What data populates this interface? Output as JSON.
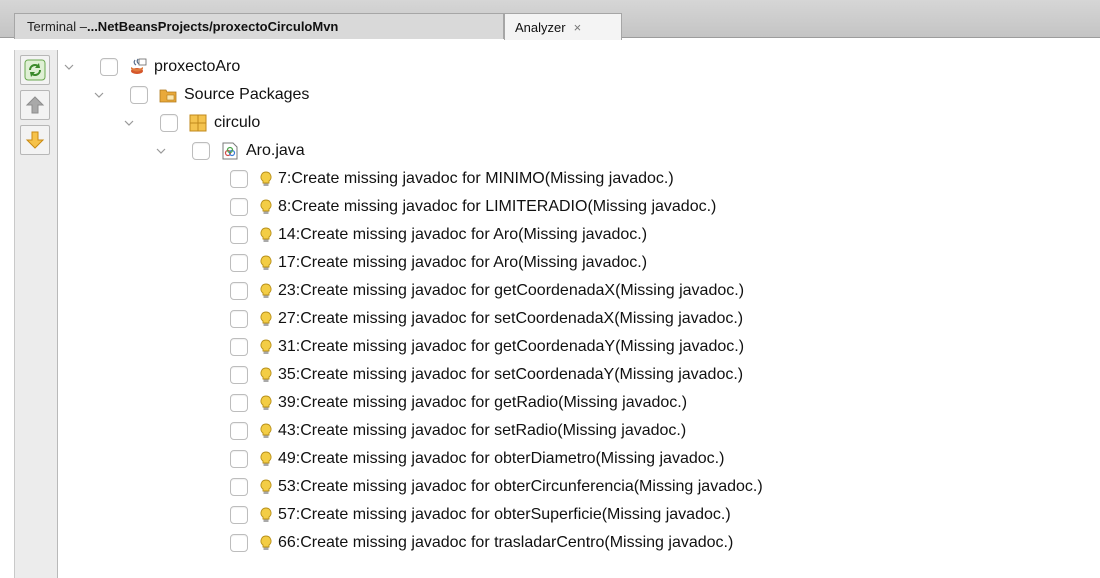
{
  "tabs": {
    "terminal": {
      "prefix": "Terminal – ",
      "path": "...NetBeansProjects/proxectoCirculoMvn"
    },
    "analyzer": {
      "label": "Analyzer",
      "close": "×"
    }
  },
  "toolbar": {
    "refresh_icon": "refresh-icon",
    "previous_icon": "arrow-up-icon",
    "next_icon": "arrow-down-icon"
  },
  "tree": {
    "project": "proxectoAro",
    "source_packages": "Source Packages",
    "package": "circulo",
    "file": "Aro.java",
    "hints": [
      "7:Create missing javadoc for MINIMO(Missing javadoc.)",
      "8:Create missing javadoc for LIMITERADIO(Missing javadoc.)",
      "14:Create missing javadoc for Aro(Missing javadoc.)",
      "17:Create missing javadoc for Aro(Missing javadoc.)",
      "23:Create missing javadoc for getCoordenadaX(Missing javadoc.)",
      "27:Create missing javadoc for setCoordenadaX(Missing javadoc.)",
      "31:Create missing javadoc for getCoordenadaY(Missing javadoc.)",
      "35:Create missing javadoc for setCoordenadaY(Missing javadoc.)",
      "39:Create missing javadoc for getRadio(Missing javadoc.)",
      "43:Create missing javadoc for setRadio(Missing javadoc.)",
      "49:Create missing javadoc for obterDiametro(Missing javadoc.)",
      "53:Create missing javadoc for obterCircunferencia(Missing javadoc.)",
      "57:Create missing javadoc for obterSuperficie(Missing javadoc.)",
      "66:Create missing javadoc for trasladarCentro(Missing javadoc.)"
    ]
  },
  "colors": {
    "bulb": "#e8b81e",
    "toolbar_bg": "#ececec",
    "tab_bar": "#c8c8c8"
  }
}
